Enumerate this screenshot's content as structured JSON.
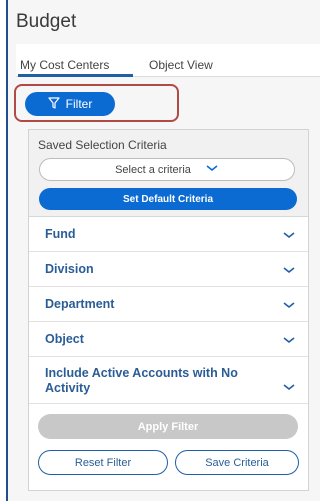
{
  "app": {
    "title": "Budget"
  },
  "tabs": [
    {
      "label": "My Cost Centers",
      "active": true
    },
    {
      "label": "Object View",
      "active": false
    }
  ],
  "filter_button": {
    "label": "Filter",
    "icon": "filter-icon",
    "color": "#0b6bd3"
  },
  "saved_selection": {
    "label": "Saved Selection Criteria",
    "select_value": "Select a criteria",
    "set_default_label": "Set Default Criteria"
  },
  "accordion": [
    {
      "label": "Fund"
    },
    {
      "label": "Division"
    },
    {
      "label": "Department"
    },
    {
      "label": "Object"
    },
    {
      "label": "Include Active Accounts with No Activity"
    }
  ],
  "actions": {
    "apply": "Apply Filter",
    "reset": "Reset Filter",
    "save": "Save Criteria"
  },
  "colors": {
    "accent": "#0b6bd3",
    "link_text": "#2a5d96",
    "disabled": "#c8c8c8",
    "highlight": "#b04a46"
  }
}
